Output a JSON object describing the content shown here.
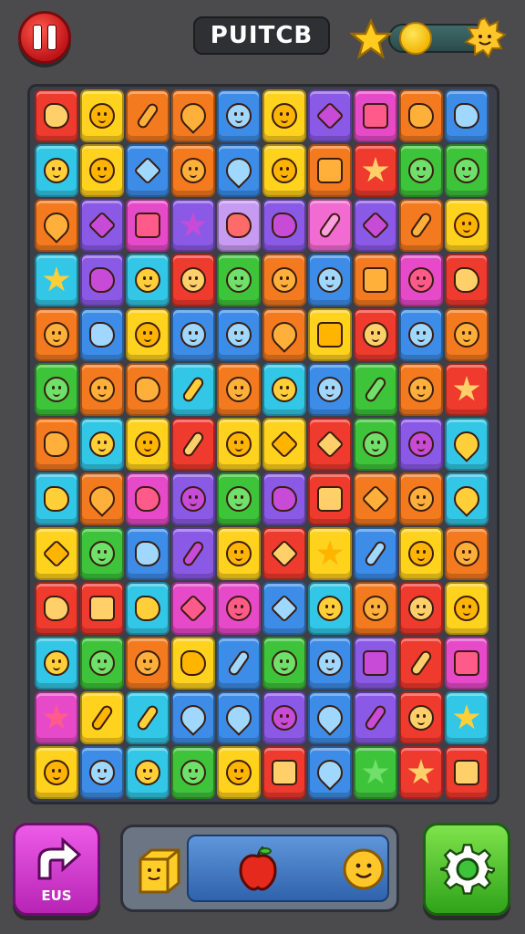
{
  "header": {
    "title": "PUITCB",
    "pause_icon": "pause-icon",
    "star_icon": "star-icon",
    "coin_icon": "coin-icon",
    "sun_icon": "smiley-sun-icon"
  },
  "board": {
    "rows": 13,
    "cols": 10,
    "tiles": [
      [
        "red",
        "yellow",
        "orange",
        "orange",
        "blue",
        "yellow",
        "purple",
        "magenta",
        "orange",
        "blue"
      ],
      [
        "cyan",
        "yellow",
        "blue",
        "orange",
        "blue",
        "yellow",
        "orange",
        "red",
        "green",
        "green"
      ],
      [
        "orange",
        "purple",
        "magenta",
        "purple",
        "lavender",
        "purple",
        "pink",
        "purple",
        "orange",
        "yellow"
      ],
      [
        "cyan",
        "purple",
        "cyan",
        "red",
        "green",
        "orange",
        "blue",
        "orange",
        "magenta",
        "red"
      ],
      [
        "orange",
        "blue",
        "yellow",
        "blue",
        "blue",
        "orange",
        "yellow",
        "red",
        "blue",
        "orange"
      ],
      [
        "green",
        "orange",
        "orange",
        "cyan",
        "orange",
        "cyan",
        "blue",
        "green",
        "orange",
        "red"
      ],
      [
        "orange",
        "cyan",
        "yellow",
        "red",
        "yellow",
        "yellow",
        "red",
        "green",
        "purple",
        "cyan"
      ],
      [
        "cyan",
        "orange",
        "magenta",
        "purple",
        "green",
        "purple",
        "red",
        "orange",
        "orange",
        "cyan"
      ],
      [
        "yellow",
        "green",
        "blue",
        "purple",
        "yellow",
        "red",
        "yellow",
        "blue",
        "yellow",
        "orange"
      ],
      [
        "red",
        "red",
        "cyan",
        "magenta",
        "magenta",
        "blue",
        "cyan",
        "orange",
        "red",
        "yellow"
      ],
      [
        "cyan",
        "green",
        "orange",
        "yellow",
        "blue",
        "green",
        "blue",
        "purple",
        "red",
        "magenta"
      ],
      [
        "magenta",
        "yellow",
        "cyan",
        "blue",
        "blue",
        "purple",
        "blue",
        "purple",
        "red",
        "cyan"
      ],
      [
        "yellow",
        "blue",
        "cyan",
        "green",
        "yellow",
        "red",
        "blue",
        "green",
        "red",
        "red"
      ]
    ],
    "gems": [
      [
        "blob",
        "face",
        "stick",
        "drop",
        "face",
        "face",
        "diamond",
        "square",
        "blob",
        "blob"
      ],
      [
        "face",
        "face",
        "diamond",
        "face",
        "drop",
        "face",
        "square",
        "star",
        "face",
        "face"
      ],
      [
        "drop",
        "diamond",
        "square",
        "star",
        "blob",
        "blob",
        "stick",
        "diamond",
        "stick",
        "face"
      ],
      [
        "star",
        "blob",
        "face",
        "face",
        "face",
        "face",
        "face",
        "square",
        "face",
        "blob"
      ],
      [
        "face",
        "blob",
        "face",
        "face",
        "face",
        "drop",
        "square",
        "face",
        "face",
        "face"
      ],
      [
        "face",
        "face",
        "blob",
        "stick",
        "face",
        "face",
        "face",
        "stick",
        "face",
        "star"
      ],
      [
        "blob",
        "face",
        "face",
        "stick",
        "face",
        "diamond",
        "diamond",
        "face",
        "face",
        "drop"
      ],
      [
        "blob",
        "drop",
        "blob",
        "face",
        "face",
        "blob",
        "square",
        "diamond",
        "face",
        "drop"
      ],
      [
        "diamond",
        "face",
        "blob",
        "stick",
        "face",
        "diamond",
        "star",
        "stick",
        "face",
        "face"
      ],
      [
        "blob",
        "square",
        "blob",
        "diamond",
        "face",
        "diamond",
        "face",
        "face",
        "face",
        "face"
      ],
      [
        "face",
        "face",
        "face",
        "blob",
        "stick",
        "face",
        "face",
        "square",
        "stick",
        "square"
      ],
      [
        "star",
        "stick",
        "stick",
        "drop",
        "drop",
        "face",
        "drop",
        "stick",
        "face",
        "star"
      ],
      [
        "face",
        "face",
        "face",
        "face",
        "face",
        "square",
        "drop",
        "star",
        "star",
        "square"
      ]
    ],
    "colors": {
      "red": "#ef3a2e",
      "yellow": "#ffd21e",
      "orange": "#f47a1f",
      "blue": "#3d8de8",
      "cyan": "#32c7e6",
      "purple": "#8a5ae6",
      "magenta": "#e64ac8",
      "green": "#3ec43a",
      "pink": "#f26bd0",
      "lavender": "#c79bf2"
    },
    "gem_colors": {
      "red": "#ffcf6a",
      "yellow": "#ffb400",
      "orange": "#ffb03a",
      "blue": "#9fd7ff",
      "cyan": "#ffcf3a",
      "purple": "#c84bd8",
      "magenta": "#ff5b8a",
      "green": "#6fe06a",
      "pink": "#ff9ee0",
      "lavender": "#ff6a6a"
    }
  },
  "footer": {
    "back_label": "EUS",
    "back_icon": "arrow-icon",
    "tray_items": [
      "cheese-block-icon",
      "apple-icon",
      "smiley-icon"
    ],
    "settings_icon": "gear-icon"
  }
}
